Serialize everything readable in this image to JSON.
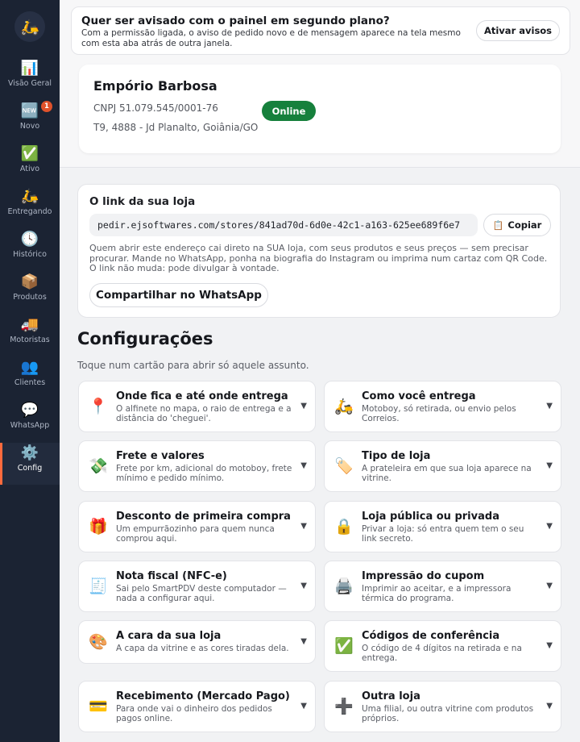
{
  "sidebar": {
    "logo_icon": "scooter-icon",
    "items": [
      {
        "label": "Visão Geral",
        "glyph": "📊"
      },
      {
        "label": "Novo",
        "glyph": "🆕",
        "badge": "1"
      },
      {
        "label": "Ativo",
        "glyph": "✅"
      },
      {
        "label": "Entregando",
        "glyph": "🛵"
      },
      {
        "label": "Histórico",
        "glyph": "🕓"
      },
      {
        "label": "Produtos",
        "glyph": "📦"
      },
      {
        "label": "Motoristas",
        "glyph": "🚚"
      },
      {
        "label": "Clientes",
        "glyph": "👥"
      },
      {
        "label": "WhatsApp",
        "glyph": "💬"
      },
      {
        "label": "Config",
        "glyph": "⚙️",
        "active": true
      }
    ]
  },
  "notify": {
    "title": "Quer ser avisado com o painel em segundo plano?",
    "text": "Com a permissão ligada, o aviso de pedido novo e de mensagem aparece na tela mesmo com esta aba atrás de outra janela.",
    "button": "Ativar avisos"
  },
  "store": {
    "name": "Empório Barbosa",
    "cnpj": "CNPJ 51.079.545/0001-76",
    "address": "T9, 4888 - Jd Planalto, Goiânia/GO",
    "status": "Online",
    "status_color": "#16803c"
  },
  "link": {
    "title": "O link da sua loja",
    "url": "pedir.ejsoftwares.com/stores/841ad70d-6d0e-42c1-a163-625ee689f6e7",
    "copy_button": "Copiar",
    "copy_icon": "📋",
    "description": "Quem abrir este endereço cai direto na SUA loja, com seus produtos e seus preços — sem precisar procurar. Mande no WhatsApp, ponha na biografia do Instagram ou imprima num cartaz com QR Code. O link não muda: pode divulgar à vontade.",
    "share_button": "Compartilhar no WhatsApp"
  },
  "settings": {
    "title": "Configurações",
    "subtitle": "Toque num cartão para abrir só aquele assunto.",
    "cards": [
      {
        "icon": "📍",
        "icon_name": "map-pin-icon",
        "title": "Onde fica e até onde entrega",
        "desc": "O alfinete no mapa, o raio de entrega e a distância do 'cheguei'."
      },
      {
        "icon": "🛵",
        "icon_name": "scooter-icon",
        "title": "Como você entrega",
        "desc": "Motoboy, só retirada, ou envio pelos Correios."
      },
      {
        "icon": "💸",
        "icon_name": "money-icon",
        "title": "Frete e valores",
        "desc": "Frete por km, adicional do motoboy, frete mínimo e pedido mínimo."
      },
      {
        "icon": "🏷️",
        "icon_name": "tag-icon",
        "title": "Tipo de loja",
        "desc": "A prateleira em que sua loja aparece na vitrine."
      },
      {
        "icon": "🎁",
        "icon_name": "gift-icon",
        "title": "Desconto de primeira compra",
        "desc": "Um empurrãozinho para quem nunca comprou aqui."
      },
      {
        "icon": "🔒",
        "icon_name": "lock-icon",
        "title": "Loja pública ou privada",
        "desc": "Privar a loja: só entra quem tem o seu link secreto."
      },
      {
        "icon": "🧾",
        "icon_name": "receipt-icon",
        "title": "Nota fiscal (NFC-e)",
        "desc": "Sai pelo SmartPDV deste computador — nada a configurar aqui."
      },
      {
        "icon": "🖨️",
        "icon_name": "printer-icon",
        "title": "Impressão do cupom",
        "desc": "Imprimir ao aceitar, e a impressora térmica do programa."
      },
      {
        "icon": "🎨",
        "icon_name": "palette-icon",
        "title": "A cara da sua loja",
        "desc": "A capa da vitrine e as cores tiradas dela."
      },
      {
        "icon": "✅",
        "icon_name": "check-icon",
        "title": "Códigos de conferência",
        "desc": "O código de 4 dígitos na retirada e na entrega."
      },
      {
        "icon": "💳",
        "icon_name": "credit-card-icon",
        "title": "Recebimento (Mercado Pago)",
        "desc": "Para onde vai o dinheiro dos pedidos pagos online."
      },
      {
        "icon": "➕",
        "icon_name": "plus-icon",
        "title": "Outra loja",
        "desc": "Uma filial, ou outra vitrine com produtos próprios."
      }
    ]
  }
}
